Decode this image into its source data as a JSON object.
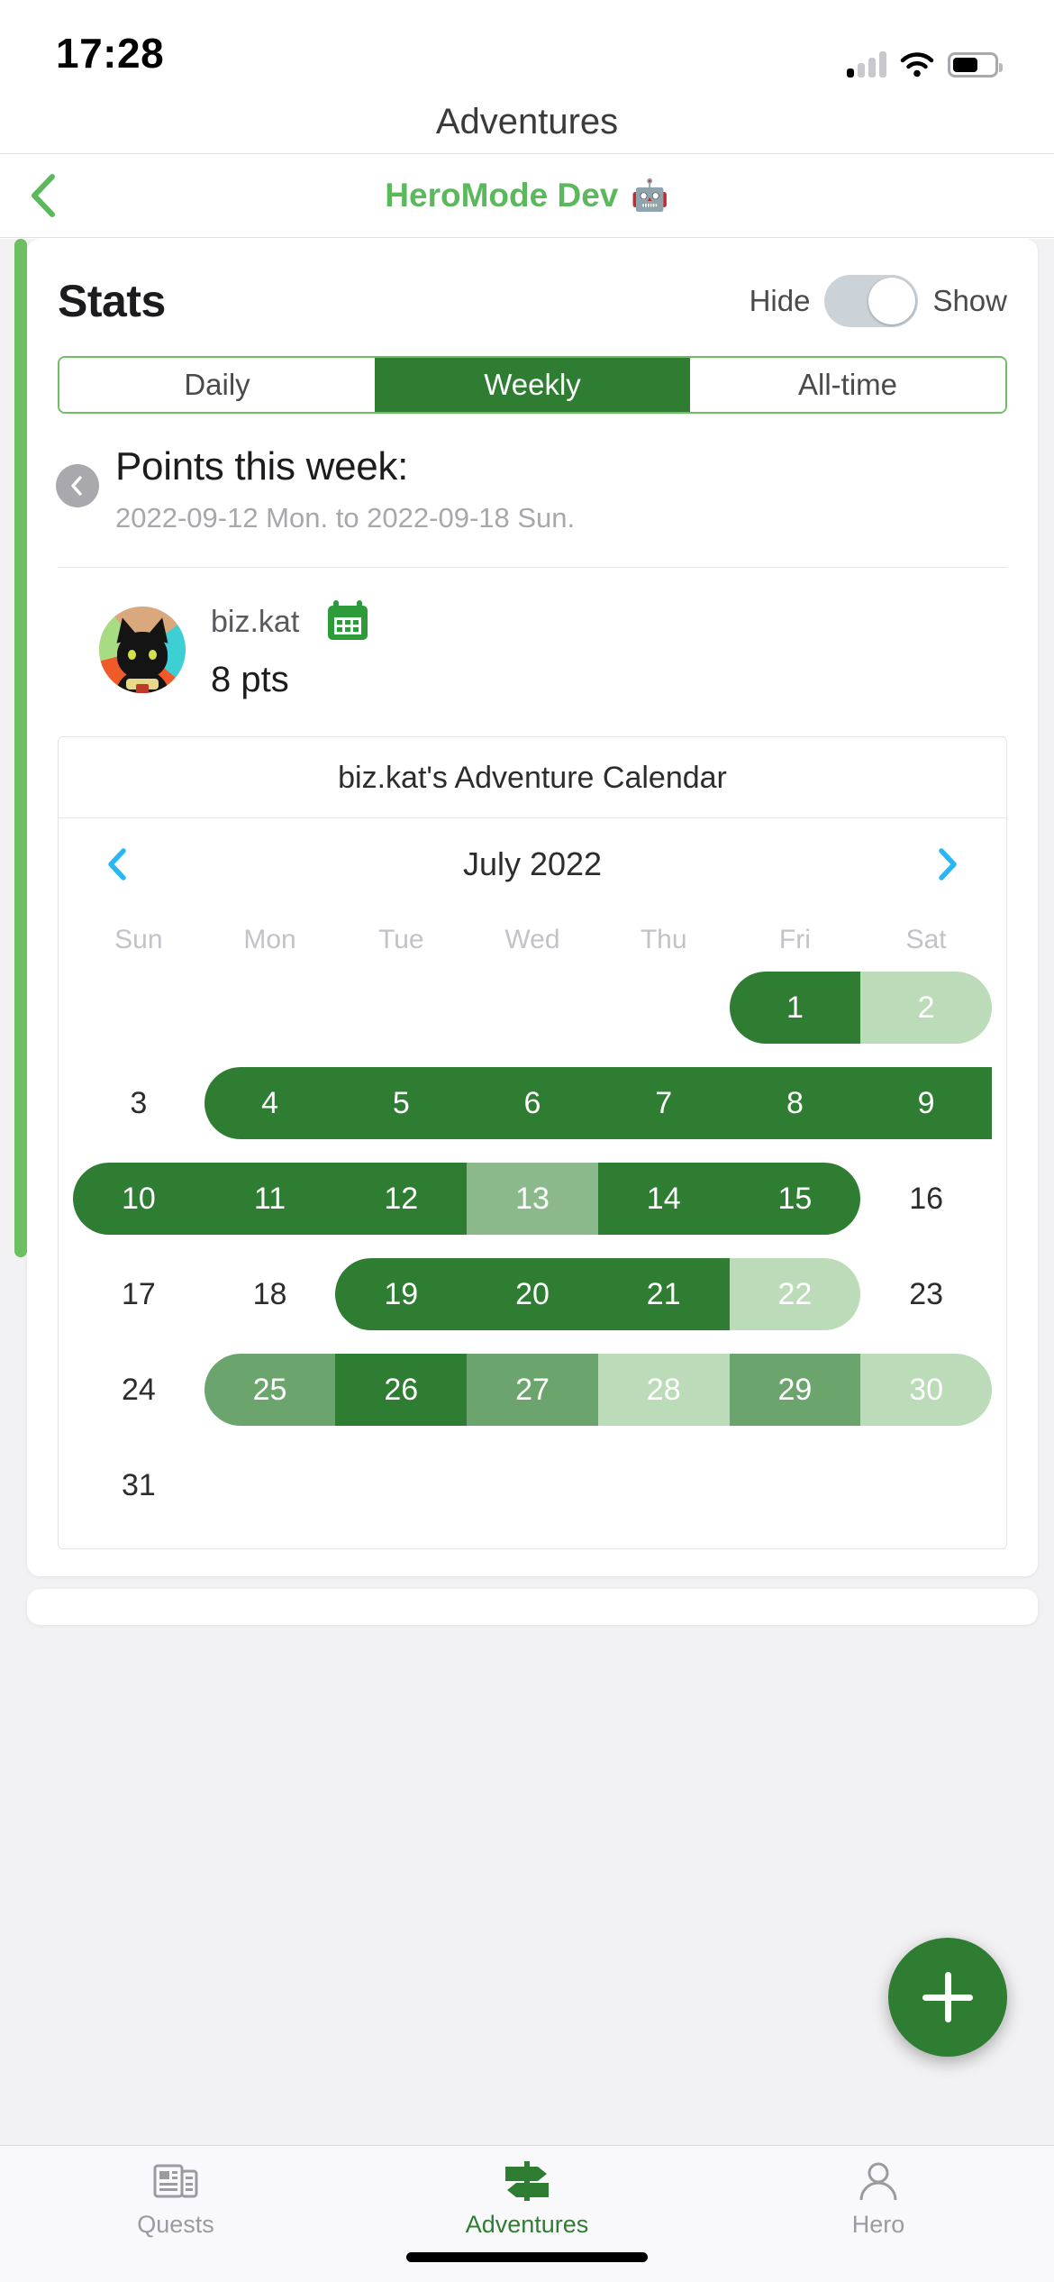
{
  "status_bar": {
    "time": "17:28",
    "icons": [
      "cellular-signal-icon",
      "wifi-icon",
      "battery-icon"
    ]
  },
  "nav": {
    "title": "Adventures"
  },
  "subheader": {
    "back_icon": "chevron-left-icon",
    "title": "HeroMode Dev",
    "emoji": "🤖",
    "color": "#5cb85c"
  },
  "stats": {
    "title": "Stats",
    "toggle": {
      "left_label": "Hide",
      "right_label": "Show",
      "state": "show"
    },
    "segments": [
      {
        "label": "Daily",
        "active": false
      },
      {
        "label": "Weekly",
        "active": true
      },
      {
        "label": "All-time",
        "active": false
      }
    ],
    "prev_period_icon": "chevron-left-circle-icon",
    "points_title": "Points this week:",
    "points_range": "2022-09-12 Mon. to 2022-09-18 Sun."
  },
  "user": {
    "avatar": "cat-avatar",
    "name": "biz.kat",
    "points": "8 pts",
    "calendar_icon": "calendar-icon"
  },
  "calendar": {
    "title": "biz.kat's Adventure Calendar",
    "prev_icon": "chevron-left-icon",
    "next_icon": "chevron-right-icon",
    "month_label": "July 2022",
    "weekdays": [
      "Sun",
      "Mon",
      "Tue",
      "Wed",
      "Thu",
      "Fri",
      "Sat"
    ],
    "level_colors": {
      "lvl0": "transparent",
      "lvl1": "#bcdcb9",
      "lvl2": "#8cb98b",
      "lvl3": "#6ba56d",
      "lvl4": "#2e7d32"
    },
    "weeks": [
      [
        {
          "day": "",
          "level": 0
        },
        {
          "day": "",
          "level": 0
        },
        {
          "day": "",
          "level": 0
        },
        {
          "day": "",
          "level": 0
        },
        {
          "day": "",
          "level": 0
        },
        {
          "day": "1",
          "level": 4,
          "round": "left"
        },
        {
          "day": "2",
          "level": 1,
          "round": "right"
        }
      ],
      [
        {
          "day": "3",
          "level": 0
        },
        {
          "day": "4",
          "level": 4,
          "round": "left"
        },
        {
          "day": "5",
          "level": 4
        },
        {
          "day": "6",
          "level": 4
        },
        {
          "day": "7",
          "level": 4
        },
        {
          "day": "8",
          "level": 4
        },
        {
          "day": "9",
          "level": 4
        }
      ],
      [
        {
          "day": "10",
          "level": 4,
          "round": "left"
        },
        {
          "day": "11",
          "level": 4
        },
        {
          "day": "12",
          "level": 4
        },
        {
          "day": "13",
          "level": 2
        },
        {
          "day": "14",
          "level": 4
        },
        {
          "day": "15",
          "level": 4,
          "round": "right"
        },
        {
          "day": "16",
          "level": 0
        }
      ],
      [
        {
          "day": "17",
          "level": 0
        },
        {
          "day": "18",
          "level": 0
        },
        {
          "day": "19",
          "level": 4,
          "round": "left"
        },
        {
          "day": "20",
          "level": 4
        },
        {
          "day": "21",
          "level": 4
        },
        {
          "day": "22",
          "level": 1,
          "round": "right"
        },
        {
          "day": "23",
          "level": 0
        }
      ],
      [
        {
          "day": "24",
          "level": 0
        },
        {
          "day": "25",
          "level": 3,
          "round": "left"
        },
        {
          "day": "26",
          "level": 4
        },
        {
          "day": "27",
          "level": 3
        },
        {
          "day": "28",
          "level": 1
        },
        {
          "day": "29",
          "level": 3
        },
        {
          "day": "30",
          "level": 1,
          "round": "right"
        }
      ],
      [
        {
          "day": "31",
          "level": 0
        },
        {
          "day": "",
          "level": 0
        },
        {
          "day": "",
          "level": 0
        },
        {
          "day": "",
          "level": 0
        },
        {
          "day": "",
          "level": 0
        },
        {
          "day": "",
          "level": 0
        },
        {
          "day": "",
          "level": 0
        }
      ]
    ]
  },
  "fab": {
    "icon": "plus-icon",
    "color": "#2e7d32"
  },
  "tabbar": {
    "items": [
      {
        "label": "Quests",
        "icon": "quests-icon",
        "active": false
      },
      {
        "label": "Adventures",
        "icon": "signpost-icon",
        "active": true
      },
      {
        "label": "Hero",
        "icon": "person-icon",
        "active": false
      }
    ],
    "active_color": "#2e7d32",
    "inactive_color": "#9a9aa0"
  }
}
